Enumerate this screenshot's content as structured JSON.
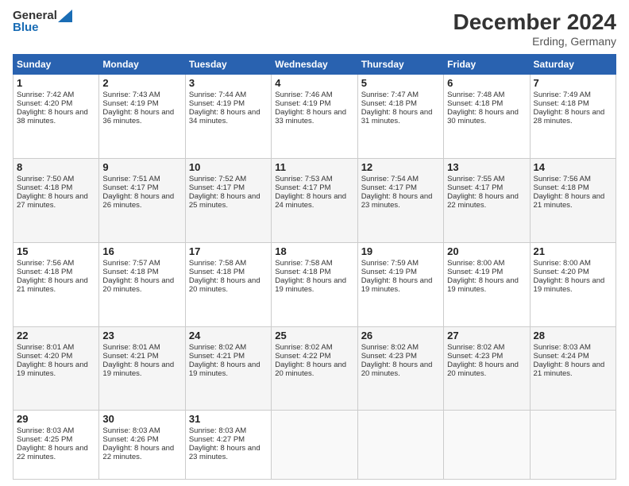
{
  "header": {
    "logo_general": "General",
    "logo_blue": "Blue",
    "title": "December 2024",
    "location": "Erding, Germany"
  },
  "weekdays": [
    "Sunday",
    "Monday",
    "Tuesday",
    "Wednesday",
    "Thursday",
    "Friday",
    "Saturday"
  ],
  "weeks": [
    [
      {
        "day": 1,
        "sunrise": "7:42 AM",
        "sunset": "4:20 PM",
        "daylight": "8 hours and 38 minutes"
      },
      {
        "day": 2,
        "sunrise": "7:43 AM",
        "sunset": "4:19 PM",
        "daylight": "8 hours and 36 minutes"
      },
      {
        "day": 3,
        "sunrise": "7:44 AM",
        "sunset": "4:19 PM",
        "daylight": "8 hours and 34 minutes"
      },
      {
        "day": 4,
        "sunrise": "7:46 AM",
        "sunset": "4:19 PM",
        "daylight": "8 hours and 33 minutes"
      },
      {
        "day": 5,
        "sunrise": "7:47 AM",
        "sunset": "4:18 PM",
        "daylight": "8 hours and 31 minutes"
      },
      {
        "day": 6,
        "sunrise": "7:48 AM",
        "sunset": "4:18 PM",
        "daylight": "8 hours and 30 minutes"
      },
      {
        "day": 7,
        "sunrise": "7:49 AM",
        "sunset": "4:18 PM",
        "daylight": "8 hours and 28 minutes"
      }
    ],
    [
      {
        "day": 8,
        "sunrise": "7:50 AM",
        "sunset": "4:18 PM",
        "daylight": "8 hours and 27 minutes"
      },
      {
        "day": 9,
        "sunrise": "7:51 AM",
        "sunset": "4:17 PM",
        "daylight": "8 hours and 26 minutes"
      },
      {
        "day": 10,
        "sunrise": "7:52 AM",
        "sunset": "4:17 PM",
        "daylight": "8 hours and 25 minutes"
      },
      {
        "day": 11,
        "sunrise": "7:53 AM",
        "sunset": "4:17 PM",
        "daylight": "8 hours and 24 minutes"
      },
      {
        "day": 12,
        "sunrise": "7:54 AM",
        "sunset": "4:17 PM",
        "daylight": "8 hours and 23 minutes"
      },
      {
        "day": 13,
        "sunrise": "7:55 AM",
        "sunset": "4:17 PM",
        "daylight": "8 hours and 22 minutes"
      },
      {
        "day": 14,
        "sunrise": "7:56 AM",
        "sunset": "4:18 PM",
        "daylight": "8 hours and 21 minutes"
      }
    ],
    [
      {
        "day": 15,
        "sunrise": "7:56 AM",
        "sunset": "4:18 PM",
        "daylight": "8 hours and 21 minutes"
      },
      {
        "day": 16,
        "sunrise": "7:57 AM",
        "sunset": "4:18 PM",
        "daylight": "8 hours and 20 minutes"
      },
      {
        "day": 17,
        "sunrise": "7:58 AM",
        "sunset": "4:18 PM",
        "daylight": "8 hours and 20 minutes"
      },
      {
        "day": 18,
        "sunrise": "7:58 AM",
        "sunset": "4:18 PM",
        "daylight": "8 hours and 19 minutes"
      },
      {
        "day": 19,
        "sunrise": "7:59 AM",
        "sunset": "4:19 PM",
        "daylight": "8 hours and 19 minutes"
      },
      {
        "day": 20,
        "sunrise": "8:00 AM",
        "sunset": "4:19 PM",
        "daylight": "8 hours and 19 minutes"
      },
      {
        "day": 21,
        "sunrise": "8:00 AM",
        "sunset": "4:20 PM",
        "daylight": "8 hours and 19 minutes"
      }
    ],
    [
      {
        "day": 22,
        "sunrise": "8:01 AM",
        "sunset": "4:20 PM",
        "daylight": "8 hours and 19 minutes"
      },
      {
        "day": 23,
        "sunrise": "8:01 AM",
        "sunset": "4:21 PM",
        "daylight": "8 hours and 19 minutes"
      },
      {
        "day": 24,
        "sunrise": "8:02 AM",
        "sunset": "4:21 PM",
        "daylight": "8 hours and 19 minutes"
      },
      {
        "day": 25,
        "sunrise": "8:02 AM",
        "sunset": "4:22 PM",
        "daylight": "8 hours and 20 minutes"
      },
      {
        "day": 26,
        "sunrise": "8:02 AM",
        "sunset": "4:23 PM",
        "daylight": "8 hours and 20 minutes"
      },
      {
        "day": 27,
        "sunrise": "8:02 AM",
        "sunset": "4:23 PM",
        "daylight": "8 hours and 20 minutes"
      },
      {
        "day": 28,
        "sunrise": "8:03 AM",
        "sunset": "4:24 PM",
        "daylight": "8 hours and 21 minutes"
      }
    ],
    [
      {
        "day": 29,
        "sunrise": "8:03 AM",
        "sunset": "4:25 PM",
        "daylight": "8 hours and 22 minutes"
      },
      {
        "day": 30,
        "sunrise": "8:03 AM",
        "sunset": "4:26 PM",
        "daylight": "8 hours and 22 minutes"
      },
      {
        "day": 31,
        "sunrise": "8:03 AM",
        "sunset": "4:27 PM",
        "daylight": "8 hours and 23 minutes"
      },
      null,
      null,
      null,
      null
    ]
  ]
}
